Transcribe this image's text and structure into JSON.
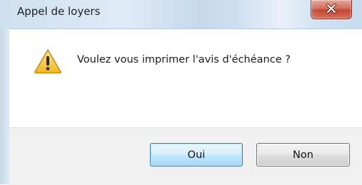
{
  "window": {
    "title": "Appel de loyers",
    "close_icon": "close-icon"
  },
  "dialog": {
    "icon": "warning-icon",
    "message": "Voulez vous imprimer l'avis d'échéance ?"
  },
  "buttons": {
    "yes_label": "Oui",
    "no_label": "Non"
  },
  "colors": {
    "warning": "#f2c230",
    "close_button": "#c24531",
    "default_button_border": "#3c7fb1"
  }
}
